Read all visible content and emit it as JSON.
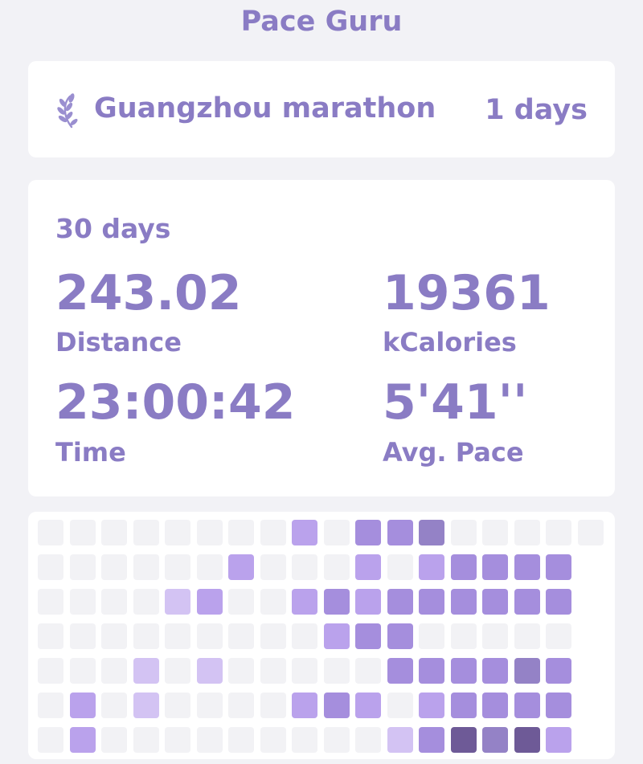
{
  "app": {
    "title": "Pace Guru"
  },
  "event": {
    "icon": "laurel-icon",
    "name": "Guangzhou marathon",
    "countdown": "1 days"
  },
  "stats": {
    "period": "30 days",
    "distance": {
      "value": "243.02",
      "label": "Distance"
    },
    "calories": {
      "value": "19361",
      "label": "kCalories"
    },
    "time": {
      "value": "23:00:42",
      "label": "Time"
    },
    "pace": {
      "value": "5'41''",
      "label": "Avg. Pace"
    }
  },
  "heatmap": {
    "colors": [
      "#f2f2f5",
      "#d3c3f3",
      "#baa2ec",
      "#a58edd",
      "#9482c6",
      "#6e5a97"
    ],
    "rows": [
      [
        0,
        0,
        0,
        0,
        0,
        0,
        0,
        0,
        2,
        0,
        3,
        3,
        4,
        0,
        0,
        0,
        0,
        0
      ],
      [
        0,
        0,
        0,
        0,
        0,
        0,
        2,
        0,
        0,
        0,
        2,
        0,
        2,
        3,
        3,
        3,
        3
      ],
      [
        0,
        0,
        0,
        0,
        1,
        2,
        0,
        0,
        2,
        3,
        2,
        3,
        3,
        3,
        3,
        3,
        3
      ],
      [
        0,
        0,
        0,
        0,
        0,
        0,
        0,
        0,
        0,
        2,
        3,
        3,
        0,
        0,
        0,
        0,
        0
      ],
      [
        0,
        0,
        0,
        1,
        0,
        1,
        0,
        0,
        0,
        0,
        0,
        3,
        3,
        3,
        3,
        4,
        3
      ],
      [
        0,
        2,
        0,
        1,
        0,
        0,
        0,
        0,
        2,
        3,
        2,
        0,
        2,
        3,
        3,
        3,
        3
      ],
      [
        0,
        2,
        0,
        0,
        0,
        0,
        0,
        0,
        0,
        0,
        0,
        1,
        3,
        5,
        4,
        5,
        2
      ]
    ]
  }
}
